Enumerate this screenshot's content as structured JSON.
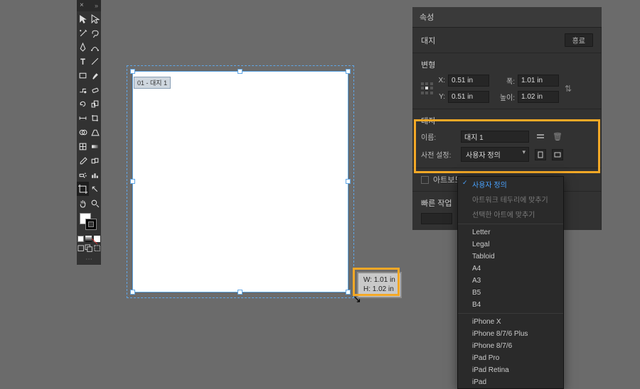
{
  "toolbar": {
    "tools": [
      "selection",
      "direct-selection",
      "magic-wand",
      "lasso",
      "pen",
      "curvature",
      "type",
      "line",
      "rectangle",
      "paintbrush",
      "shaper",
      "eraser",
      "rotate",
      "scale",
      "width",
      "free-transform",
      "shape-builder",
      "perspective",
      "mesh",
      "gradient",
      "eyedropper",
      "blend",
      "symbol-sprayer",
      "column-graph",
      "artboard",
      "slice",
      "hand",
      "zoom"
    ],
    "active_tool_index": 24
  },
  "artboard": {
    "label": "01 - 대지 1",
    "tooltip": {
      "w_label": "W:",
      "w": "1.01 in",
      "h_label": "H:",
      "h": "1.02 in"
    }
  },
  "panel": {
    "tab": "속성",
    "section_obj": {
      "title": "대지",
      "variant_btn": "흥료"
    },
    "transform": {
      "title": "변형",
      "x_label": "X:",
      "x": "0.51 in",
      "y_label": "Y:",
      "y": "0.51 in",
      "w_label": "폭:",
      "w": "1.01 in",
      "h_label": "높이:",
      "h": "1.02 in"
    },
    "artboard_section": {
      "title": "대지",
      "name_label": "이름:",
      "name_value": "대지 1",
      "preset_label": "사전 설정:",
      "preset_value": "사용자 정의"
    },
    "artwork_line": "아트보드",
    "quick_actions": {
      "title": "빠른 작업"
    },
    "dropdown": {
      "selected": "사용자 정의",
      "fit_art_bounds": "아트워크 테두리에 맞추기",
      "fit_selected": "선택한 아트에 맞추기",
      "items": [
        "Letter",
        "Legal",
        "Tabloid",
        "A4",
        "A3",
        "B5",
        "B4"
      ],
      "devices": [
        "iPhone X",
        "iPhone 8/7/6 Plus",
        "iPhone 8/7/6",
        "iPad Pro",
        "iPad Retina",
        "iPad"
      ]
    }
  }
}
